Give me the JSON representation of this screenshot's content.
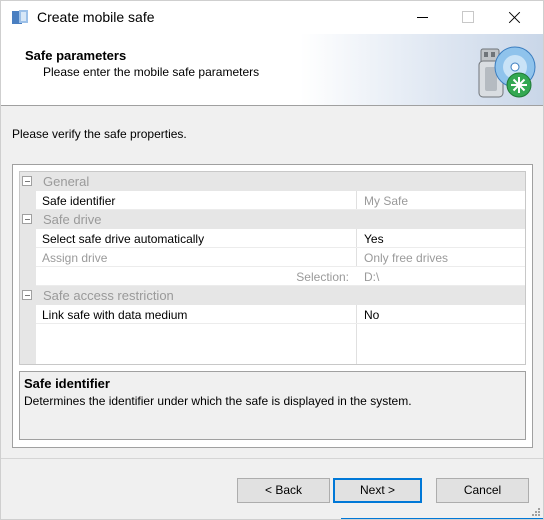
{
  "window": {
    "title": "Create mobile safe",
    "icon": "safe-app-icon",
    "controls": [
      "minimize-icon",
      "maximize-icon",
      "close-icon"
    ]
  },
  "header": {
    "title": "Safe parameters",
    "subtitle": "Please enter the mobile safe parameters",
    "icon": "usb-drive-with-disc-icon"
  },
  "intro": "Please verify the safe properties.",
  "grid": {
    "categories": {
      "general": "General",
      "safe_drive": "Safe drive",
      "access": "Safe access restriction"
    },
    "rows": {
      "safe_identifier": {
        "name": "Safe identifier",
        "value": "My Safe"
      },
      "auto_select": {
        "name": "Select safe drive automatically",
        "value": "Yes"
      },
      "assign_drive": {
        "name": "Assign drive",
        "value": "Only free drives"
      },
      "selection": {
        "label": "Selection:",
        "value": "D:\\"
      },
      "link_medium": {
        "name": "Link safe with data medium",
        "value": "No"
      }
    }
  },
  "description": {
    "title": "Safe identifier",
    "text": "Determines the identifier under which the safe is displayed in the system."
  },
  "buttons": {
    "back": "< Back",
    "next": "Next >",
    "cancel": "Cancel"
  },
  "colors": {
    "accent": "#0078d7",
    "category_bg": "#e6e6e6",
    "disabled_text": "#9a9a9a"
  }
}
